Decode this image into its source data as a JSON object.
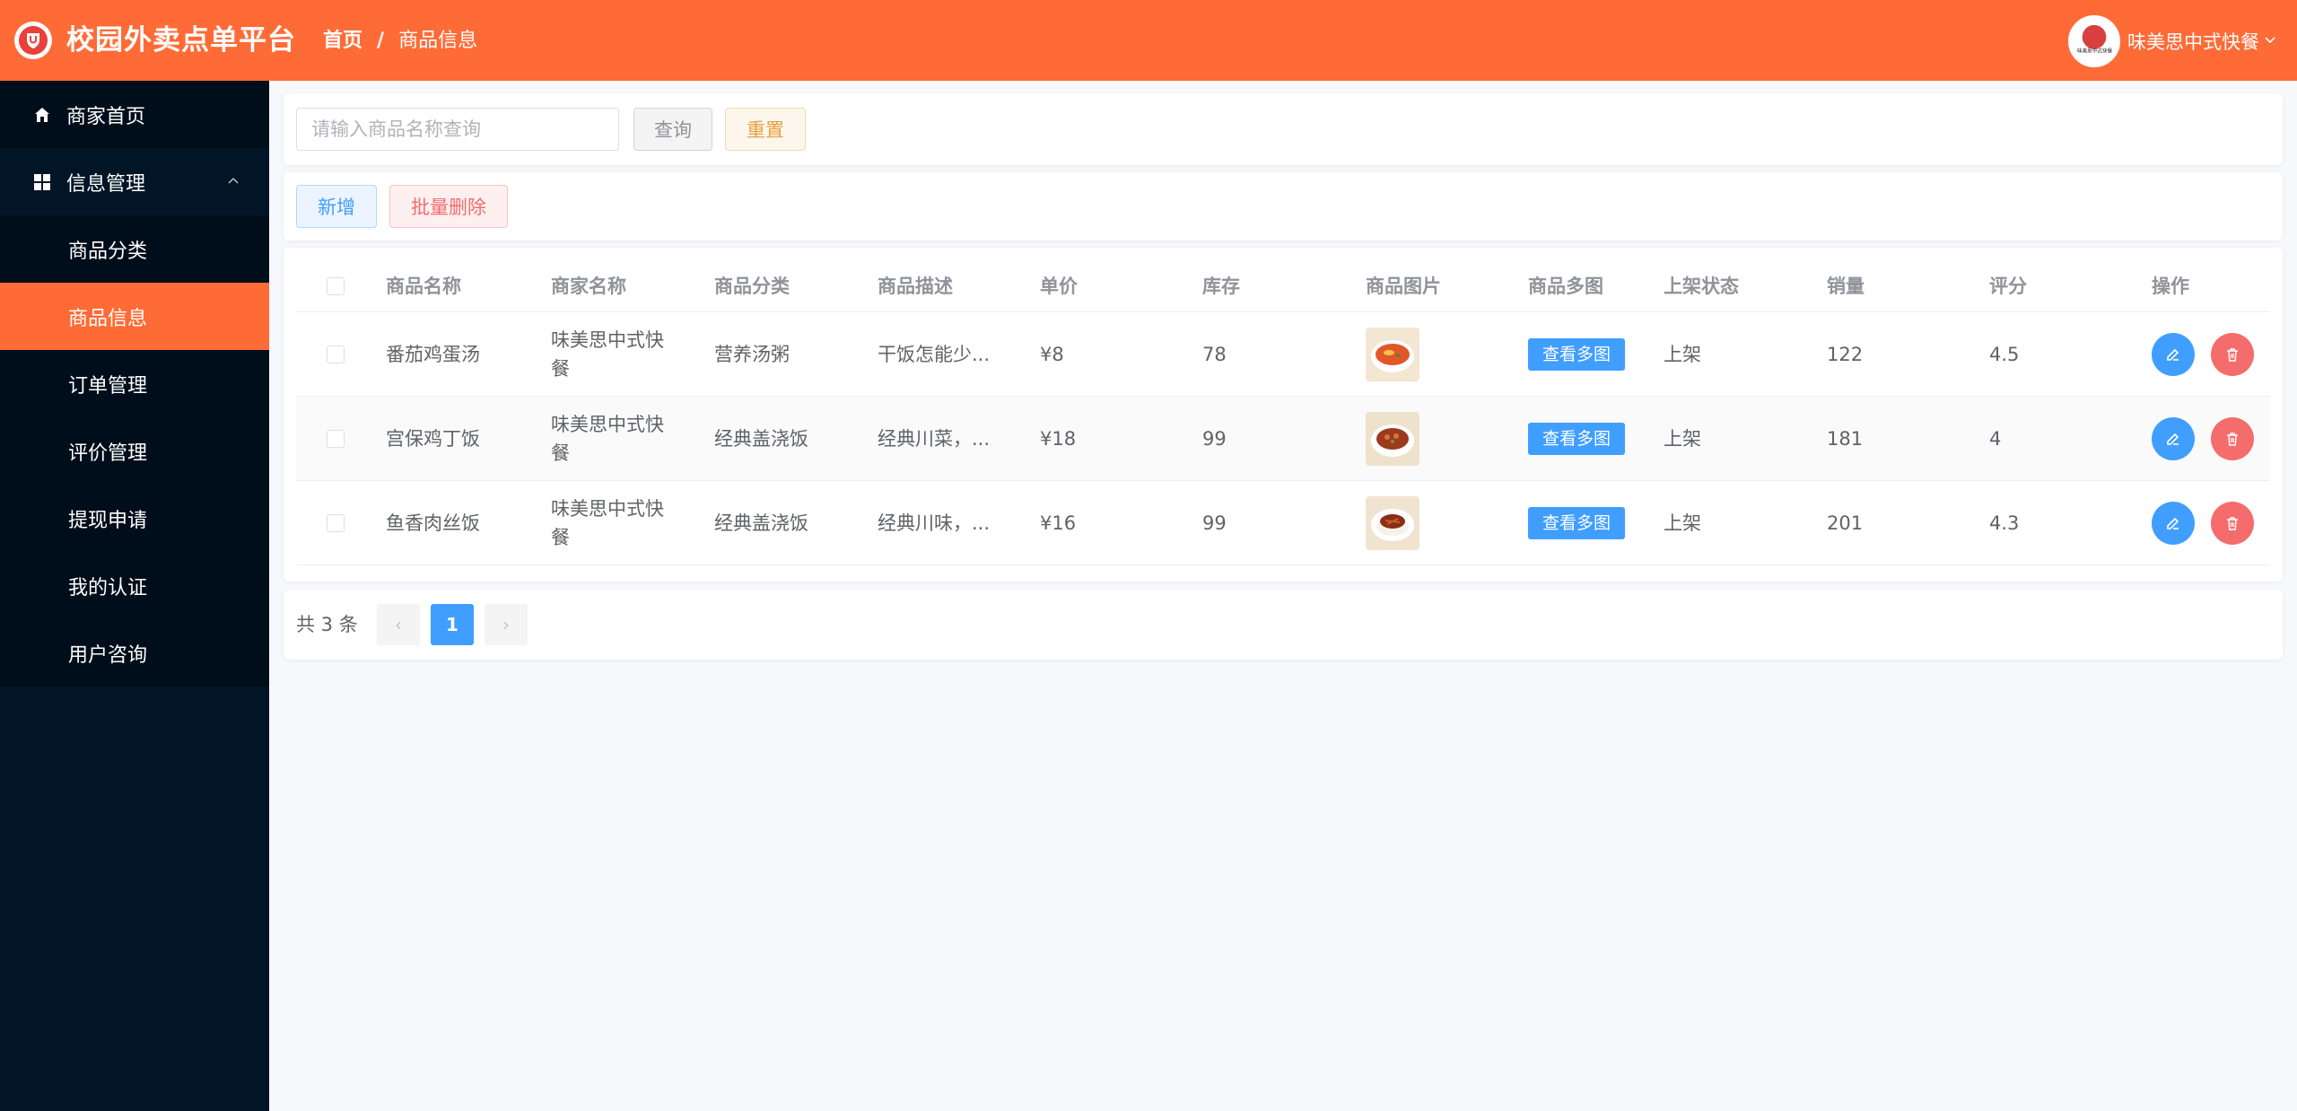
{
  "header": {
    "app_title": "校园外卖点单平台",
    "breadcrumb_home": "首页",
    "breadcrumb_sep": "/",
    "breadcrumb_current": "商品信息",
    "user_name": "味美思中式快餐",
    "avatar_text": "味美思中式快餐",
    "bg_color": "#ff6b36"
  },
  "sidebar": {
    "items": [
      {
        "label": "商家首页",
        "icon": "home-icon"
      },
      {
        "label": "信息管理",
        "icon": "grid-icon",
        "expanded": true
      },
      {
        "label": "商品分类"
      },
      {
        "label": "商品信息",
        "active": true
      },
      {
        "label": "订单管理"
      },
      {
        "label": "评价管理"
      },
      {
        "label": "提现申请"
      },
      {
        "label": "我的认证"
      },
      {
        "label": "用户咨询"
      }
    ]
  },
  "search": {
    "placeholder": "请输入商品名称查询",
    "value": "",
    "query_label": "查询",
    "reset_label": "重置"
  },
  "actions": {
    "add_label": "新增",
    "batch_delete_label": "批量删除"
  },
  "table": {
    "columns": [
      "商品名称",
      "商家名称",
      "商品分类",
      "商品描述",
      "单价",
      "库存",
      "商品图片",
      "商品多图",
      "上架状态",
      "销量",
      "评分",
      "操作"
    ],
    "view_images_label": "查看多图",
    "rows": [
      {
        "name": "番茄鸡蛋汤",
        "merchant_l1": "味美思中式快",
        "merchant_l2": "餐",
        "category": "营养汤粥",
        "desc": "干饭怎能少...",
        "price": "¥8",
        "stock": "78",
        "status": "上架",
        "sales": "122",
        "rating": "4.5"
      },
      {
        "name": "宫保鸡丁饭",
        "merchant_l1": "味美思中式快",
        "merchant_l2": "餐",
        "category": "经典盖浇饭",
        "desc": "经典川菜，...",
        "price": "¥18",
        "stock": "99",
        "status": "上架",
        "sales": "181",
        "rating": "4"
      },
      {
        "name": "鱼香肉丝饭",
        "merchant_l1": "味美思中式快",
        "merchant_l2": "餐",
        "category": "经典盖浇饭",
        "desc": "经典川味，...",
        "price": "¥16",
        "stock": "99",
        "status": "上架",
        "sales": "201",
        "rating": "4.3"
      }
    ]
  },
  "pagination": {
    "total_label": "共 3 条",
    "current_page": "1",
    "prev": "‹",
    "next": "›"
  }
}
